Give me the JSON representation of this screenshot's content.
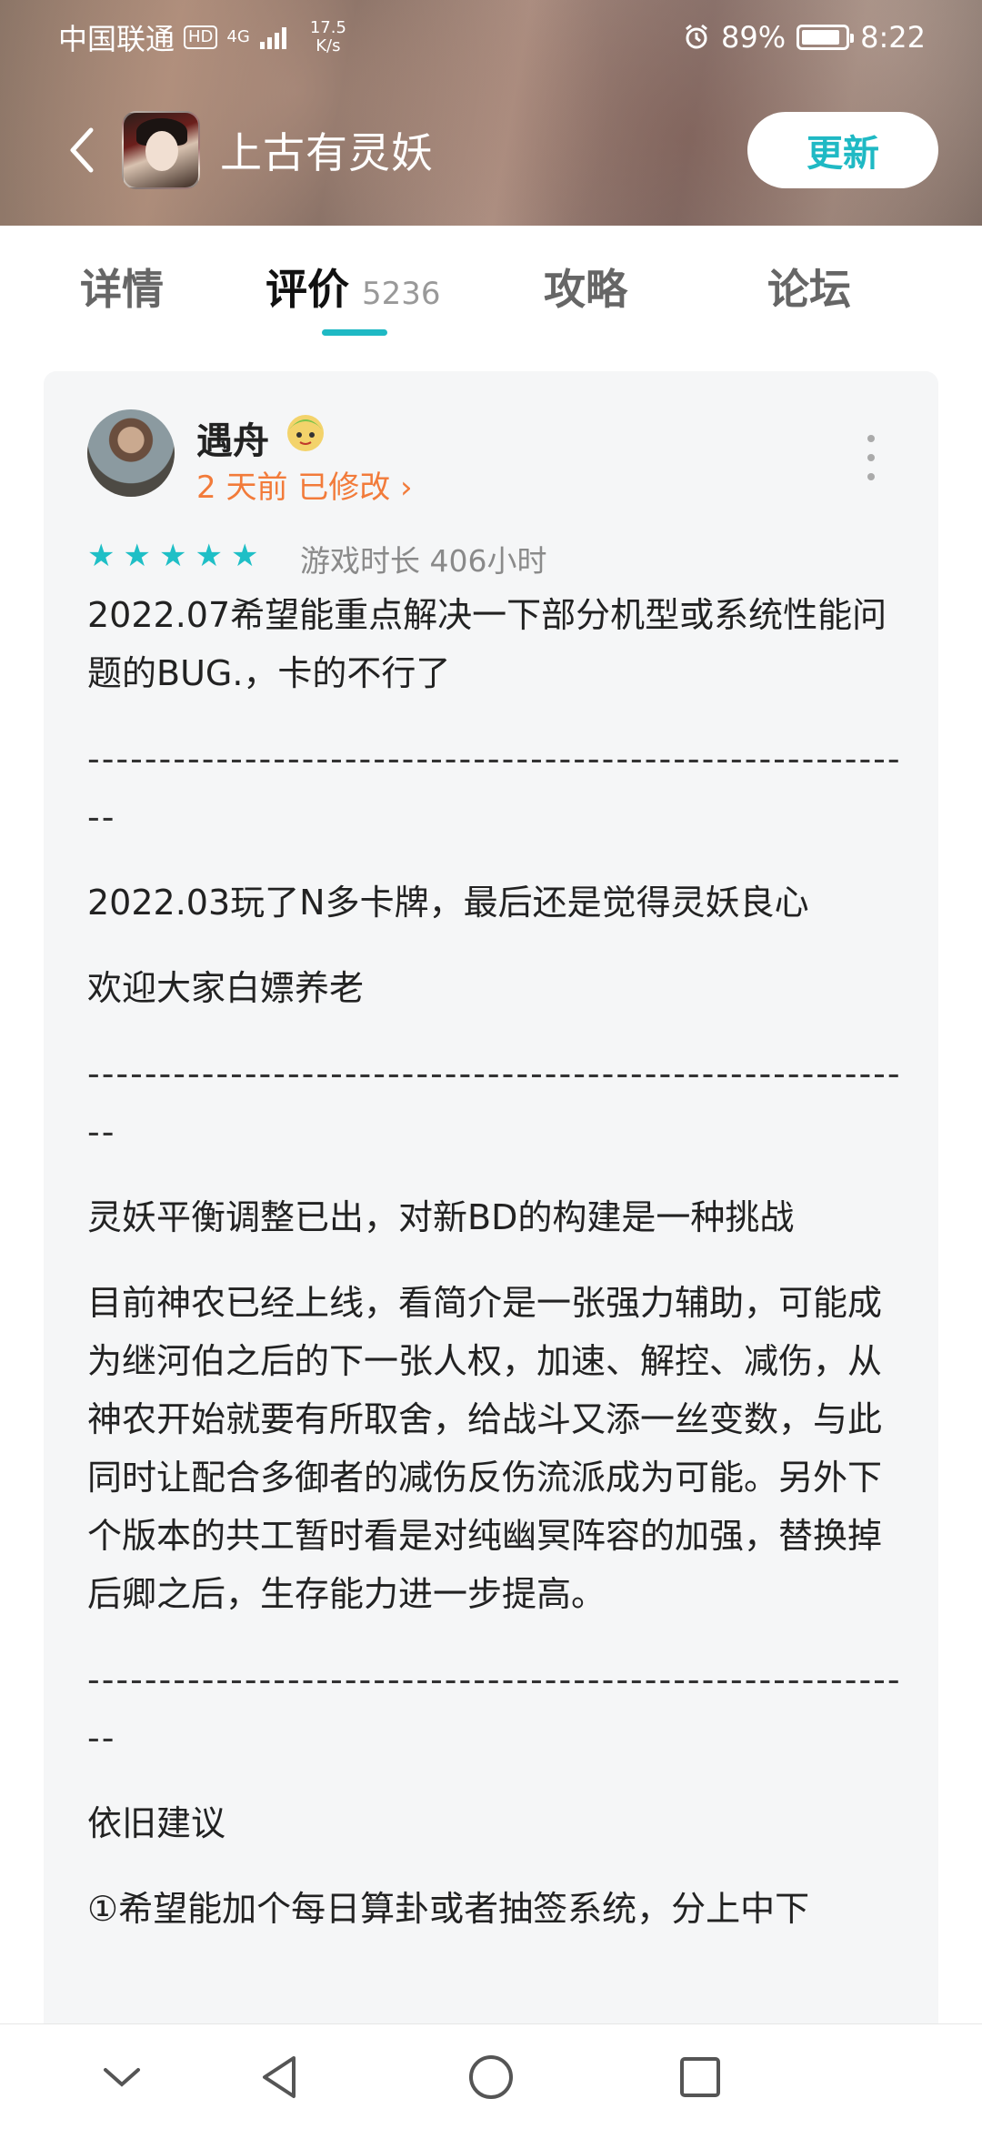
{
  "status_bar": {
    "carrier": "中国联通",
    "hd": "HD",
    "network": "4G",
    "net_speed_value": "17.5",
    "net_speed_unit": "K/s",
    "battery_percent": "89%",
    "battery_level": 0.89,
    "time": "8:22"
  },
  "header": {
    "app_title": "上古有灵妖",
    "update_label": "更新"
  },
  "tabs": {
    "details": "详情",
    "reviews": "评价",
    "reviews_count": "5236",
    "guides": "攻略",
    "forum": "论坛",
    "accent_color": "#1fb9c4"
  },
  "review": {
    "username": "遇舟",
    "time": "2 天前 已修改 ›",
    "rating": 5,
    "playtime": "游戏时长 406小时",
    "paragraphs": [
      "2022.07希望能重点解决一下部分机型或系统性能问题的BUG.，卡的不行了",
      "-----------------------------------------------------------",
      "2022.03玩了N多卡牌，最后还是觉得灵妖良心",
      "欢迎大家白嫖养老",
      "-----------------------------------------------------------",
      "灵妖平衡调整已出，对新BD的构建是一种挑战",
      "目前神农已经上线，看简介是一张强力辅助，可能成为继河伯之后的下一张人权，加速、解控、减伤，从神农开始就要有所取舍，给战斗又添一丝变数，与此同时让配合多御者的减伤反伤流派成为可能。另外下个版本的共工暂时看是对纯幽冥阵容的加强，替换掉后卿之后，生存能力进一步提高。",
      "-----------------------------------------------------------",
      "依旧建议",
      "①希望能加个每日算卦或者抽签系统，分上中下"
    ]
  }
}
